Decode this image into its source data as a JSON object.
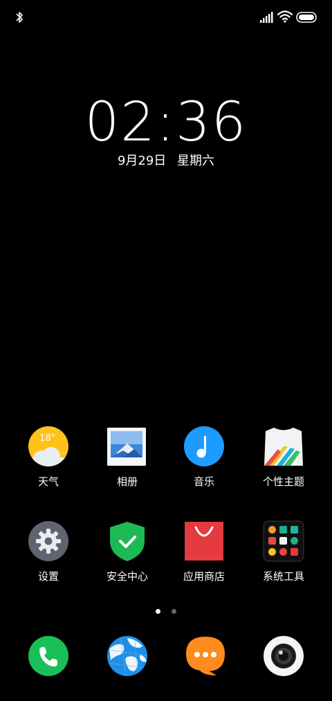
{
  "status_bar": {
    "icons": [
      "bluetooth-icon",
      "signal-icon",
      "wifi-icon",
      "battery-icon"
    ]
  },
  "lock_clock": {
    "time": "02:36",
    "date": "9月29日",
    "weekday": "星期六"
  },
  "weather_widget": {
    "temperature": "18°"
  },
  "apps_row1": [
    {
      "label": "天气",
      "icon": "weather-icon"
    },
    {
      "label": "相册",
      "icon": "gallery-icon"
    },
    {
      "label": "音乐",
      "icon": "music-icon"
    },
    {
      "label": "个性主题",
      "icon": "themes-icon"
    }
  ],
  "apps_row2": [
    {
      "label": "设置",
      "icon": "settings-icon"
    },
    {
      "label": "安全中心",
      "icon": "security-icon"
    },
    {
      "label": "应用商店",
      "icon": "app-store-icon"
    },
    {
      "label": "系统工具",
      "icon": "system-tools-folder-icon"
    }
  ],
  "dock": [
    {
      "icon": "phone-icon"
    },
    {
      "icon": "browser-icon"
    },
    {
      "icon": "messages-icon"
    },
    {
      "icon": "camera-icon"
    }
  ],
  "pager": {
    "pages": 2,
    "current": 1
  },
  "colors": {
    "background": "#000000",
    "weather": "#FFC21A",
    "music": "#1E9BFF",
    "settings": "#5E6570",
    "security": "#1DB954",
    "store": "#E53A40",
    "phone": "#1BBF5A",
    "messages": "#FF8A1E"
  }
}
